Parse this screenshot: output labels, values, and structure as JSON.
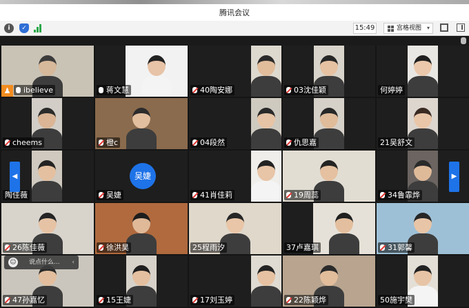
{
  "window": {
    "title": "腾讯会议"
  },
  "toolbar": {
    "time": "15:49",
    "view_label": "宫格视图",
    "icons": [
      "info-icon",
      "shield-icon",
      "signal-icon",
      "fullscreen-icon",
      "sidebar-toggle-icon"
    ]
  },
  "participants": [
    {
      "name": "ibelieve",
      "mic": "on",
      "host": true
    },
    {
      "name": "蒋文慧",
      "mic": "on"
    },
    {
      "name": "40陶安娜",
      "mic": "off"
    },
    {
      "name": "03沈佳颖",
      "mic": "off"
    },
    {
      "name": "何婷婷",
      "mic": "none"
    },
    {
      "name": "cheems",
      "mic": "off"
    },
    {
      "name": "橙c",
      "mic": "off"
    },
    {
      "name": "04段然",
      "mic": "off"
    },
    {
      "name": "仇思嘉",
      "mic": "off"
    },
    {
      "name": "21吴舒文",
      "mic": "none"
    },
    {
      "name": "陶佳薇",
      "mic": "none"
    },
    {
      "name": "吴婕",
      "mic": "off",
      "avatar_text": "吴婕"
    },
    {
      "name": "41肖佳莉",
      "mic": "off"
    },
    {
      "name": "19周蕊",
      "mic": "off"
    },
    {
      "name": "34鲁霏烨",
      "mic": "off"
    },
    {
      "name": "26陈佳薇",
      "mic": "off"
    },
    {
      "name": "徐洪昊",
      "mic": "off"
    },
    {
      "name": "25程雨汐",
      "mic": "none"
    },
    {
      "name": "37卢嘉琪",
      "mic": "none"
    },
    {
      "name": "31郭馨",
      "mic": "off"
    },
    {
      "name": "47孙嘉忆",
      "mic": "off"
    },
    {
      "name": "15王婕",
      "mic": "off"
    },
    {
      "name": "17刘玉婷",
      "mic": "off"
    },
    {
      "name": "22陈颖烨",
      "mic": "off"
    },
    {
      "name": "50施宇樊",
      "mic": "none"
    }
  ],
  "chat": {
    "placeholder": "说点什么..."
  },
  "colors": {
    "accent": "#1e73e8",
    "host_badge": "#f28c1f",
    "mic_muted": "#e53935"
  }
}
